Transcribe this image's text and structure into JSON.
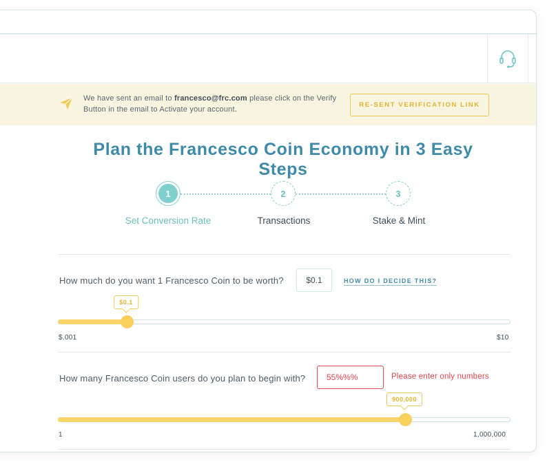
{
  "banner": {
    "text_before": "We have sent an email to ",
    "email": "francesco@frc.com",
    "text_after": " please click on the Verify Button in the email to Activate your account.",
    "resend_label": "RE-SENT VERIFICATION LINK",
    "icon": "paper-plane-icon"
  },
  "header": {
    "support_icon": "headset-icon"
  },
  "page": {
    "title": "Plan the Francesco Coin Economy in 3 Easy Steps"
  },
  "steps": [
    {
      "number": "1",
      "label": "Set Conversion Rate",
      "state": "active"
    },
    {
      "number": "2",
      "label": "Transactions",
      "state": "pending"
    },
    {
      "number": "3",
      "label": "Stake & Mint",
      "state": "pending"
    }
  ],
  "conversion": {
    "question": "How much do you want 1 Francesco Coin to be worth?",
    "value": "$0.1",
    "help_link": "HOW DO I DECIDE THIS?",
    "slider": {
      "min_label": "$.001",
      "max_label": "$10",
      "tooltip": "$0.1",
      "position_fraction": 0.15
    }
  },
  "users": {
    "question": "How many Francesco Coin users do you plan to begin with?",
    "value": "55%%%",
    "error": "Please enter only numbers",
    "slider": {
      "min_label": "1",
      "max_label": "1,000,000",
      "tooltip": "900,000",
      "position_fraction": 0.765
    }
  },
  "colors": {
    "accent_teal": "#3f8aa8",
    "step_teal": "#7fcfcf",
    "slider_yellow": "#f8d46a",
    "banner_bg": "#faf5e0",
    "error_red": "#e0474c"
  }
}
